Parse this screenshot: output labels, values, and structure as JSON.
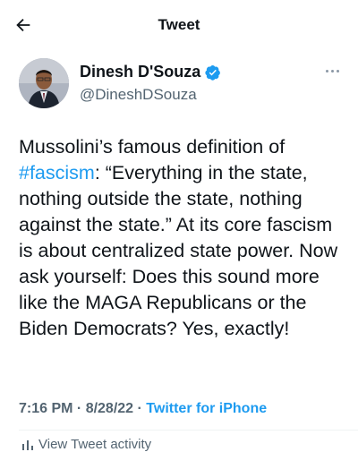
{
  "header": {
    "title": "Tweet",
    "back_icon": "arrow-left-icon"
  },
  "author": {
    "name": "Dinesh D'Souza",
    "handle": "@DineshDSouza",
    "verified_icon": "verified-badge-icon",
    "more_icon": "more-horizontal-icon"
  },
  "tweet": {
    "text_before": "Mussolini’s famous definition of\n",
    "hashtag": "#fascism",
    "text_after": ": “Everything in the state, nothing outside the state, nothing against the state.” At its core fascism is about centralized state power. Now ask yourself: Does this sound more like the MAGA Republicans or the Biden Democrats? Yes, exactly!",
    "timestamp": "7:16 PM · 8/28/22 · ",
    "source": "Twitter for iPhone"
  },
  "activity": {
    "label": "View Tweet activity",
    "icon": "bar-chart-icon"
  },
  "colors": {
    "link": "#1d9bf0",
    "text": "#0f1419",
    "secondary": "#536471"
  }
}
